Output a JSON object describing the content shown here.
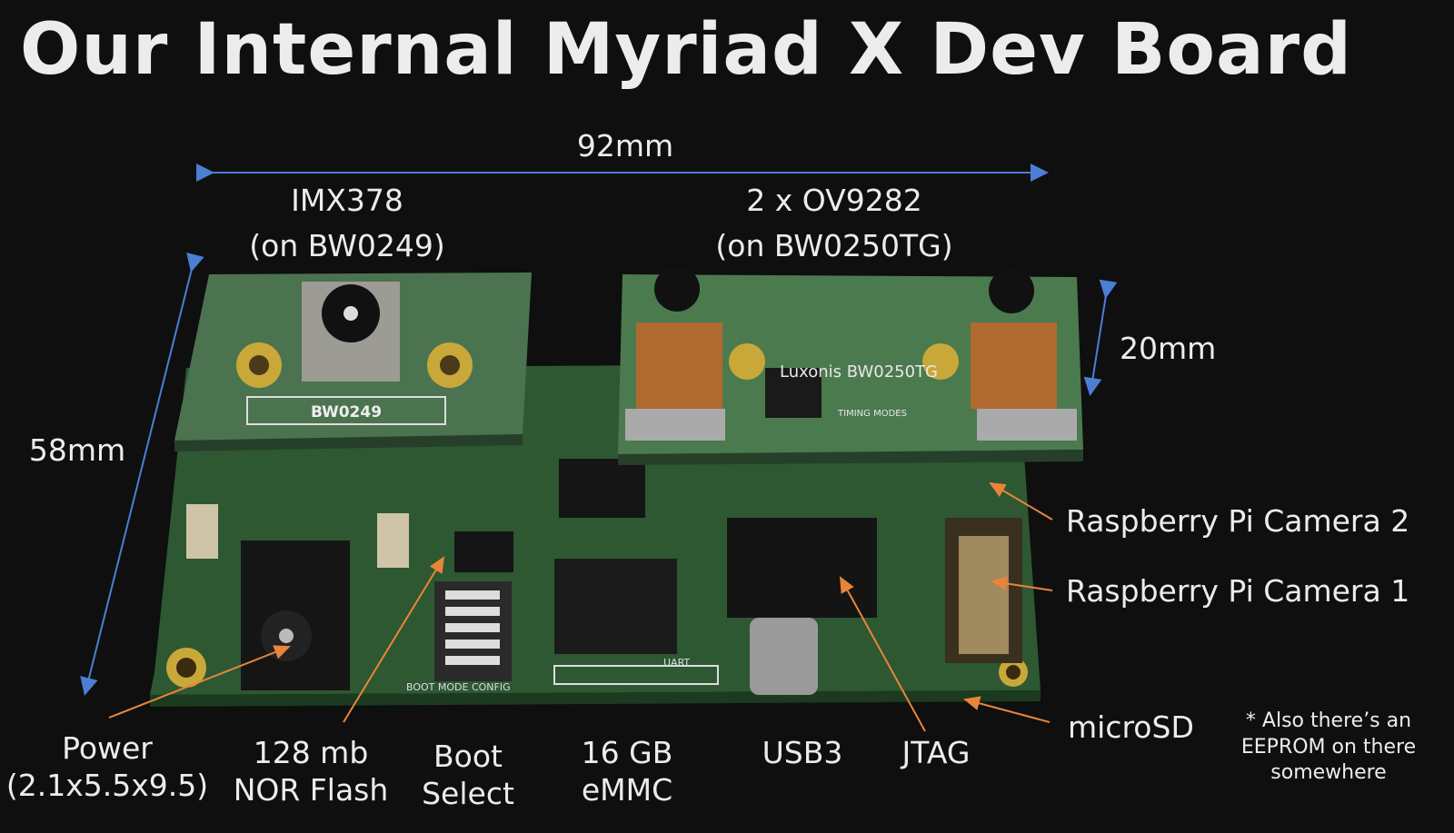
{
  "slide": {
    "title": "Our Internal Myriad X Dev Board",
    "dimensions": {
      "width": "92mm",
      "height": "58mm",
      "depth": "20mm"
    },
    "cameras": {
      "left": {
        "sensor": "IMX378",
        "board": "(on BW0249)"
      },
      "right": {
        "sensor": "2 x OV9282",
        "board": "(on BW0250TG)"
      }
    },
    "callouts_right": [
      {
        "label": "Raspberry Pi Camera 2"
      },
      {
        "label": "Raspberry Pi Camera 1"
      },
      {
        "label": "microSD"
      }
    ],
    "callouts_bottom": [
      {
        "line1": "Power",
        "line2": "(2.1x5.5x9.5)"
      },
      {
        "line1": "128 mb",
        "line2": "NOR Flash"
      },
      {
        "line1": "Boot",
        "line2": "Select"
      },
      {
        "line1": "16 GB",
        "line2": "eMMC"
      },
      {
        "line1": "USB3"
      },
      {
        "line1": "JTAG"
      }
    ],
    "footnote": [
      "* Also there’s an",
      "EEPROM on there",
      "somewhere"
    ],
    "board_silkscreen": {
      "left_board": "BW0249",
      "right_board": "Luxonis BW0250TG",
      "timing": "TIMING MODES",
      "boot": "BOOT MODE CONFIG",
      "uart": "UART"
    },
    "colors": {
      "background": "#0f0f0f",
      "dimension_arrow": "#4a7fd4",
      "callout_arrow": "#e8853a",
      "pcb": "#2f5a33",
      "text": "#ececec"
    }
  }
}
